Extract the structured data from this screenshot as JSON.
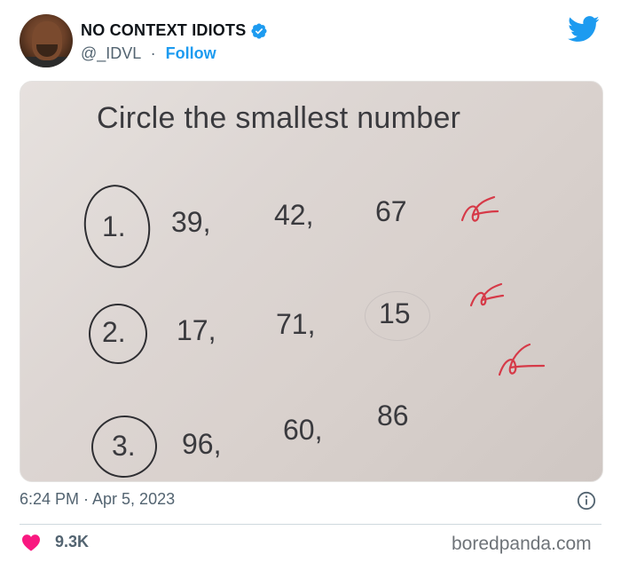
{
  "author": {
    "name": "NO CONTEXT IDIOTS",
    "handle": "@_IDVL",
    "separator": "·",
    "follow_label": "Follow"
  },
  "photo": {
    "prompt": "Circle the smallest number",
    "questions": [
      {
        "num": "1.",
        "values": [
          "39,",
          "42,",
          "67"
        ]
      },
      {
        "num": "2.",
        "values": [
          "17,",
          "71,",
          "15"
        ]
      },
      {
        "num": "3.",
        "values": [
          "96,",
          "60,",
          "86"
        ]
      }
    ]
  },
  "footer": {
    "timestamp": "6:24 PM · Apr 5, 2023",
    "like_count": "9.3K",
    "watermark": "boredpanda.com"
  },
  "colors": {
    "accent": "#1d9bf0",
    "heart": "#f91880",
    "muted_text": "#536471",
    "red_ink": "#d63a48"
  },
  "icons": [
    "verified-badge-icon",
    "twitter-bird-icon",
    "info-icon",
    "heart-icon"
  ]
}
